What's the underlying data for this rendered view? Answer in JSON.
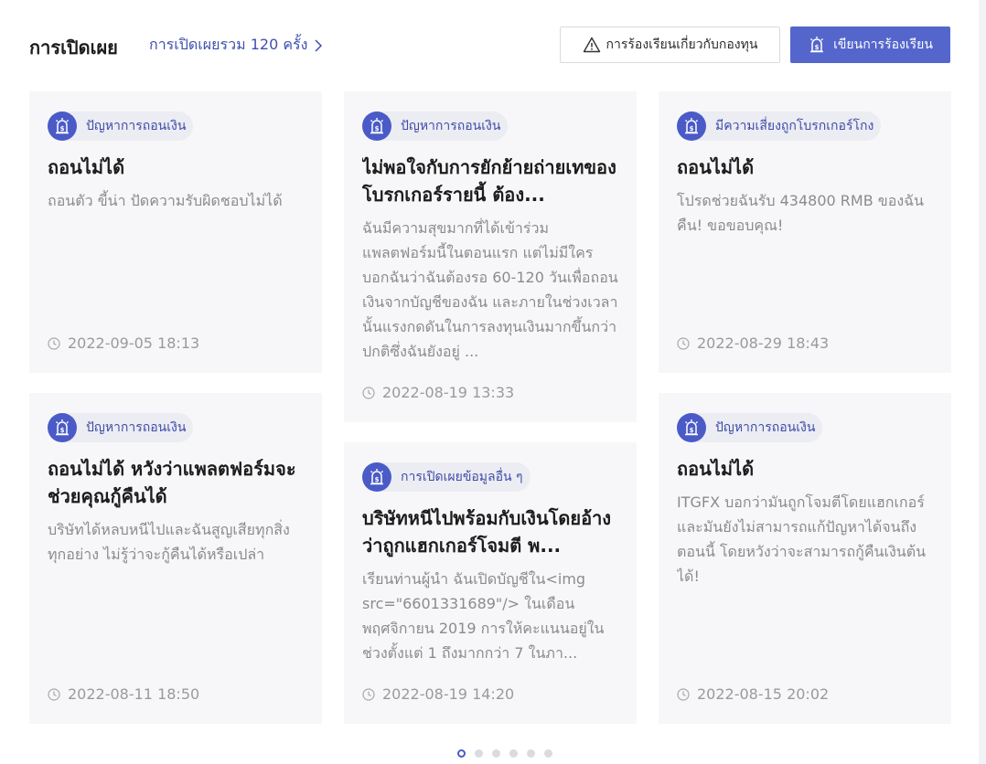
{
  "header": {
    "title": "การเปิดเผย",
    "count_link": "การเปิดเผยรวม 120 ครั้ง",
    "complain_button": "การร้องเรียนเกี่ยวกับกองทุน",
    "write_button": "เขียนการร้องเรียน"
  },
  "colors": {
    "accent": "#5466cc",
    "badge": "#4a5bc7",
    "card_bg": "#f7f7f9"
  },
  "icons": {
    "tag": "shield-dollar-icon",
    "date": "clock-icon",
    "warning": "warning-triangle-icon",
    "chevron": "chevron-right-icon"
  },
  "cards": [
    {
      "tag": "ปัญหาการถอนเงิน",
      "title": "ถอนไม่ได้",
      "body": "ถอนตัว ขี้น่า ปัดความรับผิดชอบไม่ได้",
      "date": "2022-09-05 18:13"
    },
    {
      "tag": "ปัญหาการถอนเงิน",
      "title": "ไม่พอใจกับการยักย้ายถ่ายเทของโบรกเกอร์รายนี้ ต้อง...",
      "body": "ฉันมีความสุขมากที่ได้เข้าร่วมแพลตฟอร์มนี้ในตอนแรก แต่ไม่มีใครบอกฉันว่าฉันต้องรอ 60-120 วันเพื่อถอนเงินจากบัญชีของฉัน และภายในช่วงเวลานั้นแรงกดดันในการลงทุนเงินมากขึ้นกว่าปกติซึ่งฉันยังอยู่ ...",
      "date": "2022-08-19 13:33"
    },
    {
      "tag": "มีความเสี่ยงถูกโบรกเกอร์โกง",
      "title": "ถอนไม่ได้",
      "body": "โปรดช่วยฉันรับ 434800 RMB ของฉันคืน! ขอขอบคุณ!",
      "date": "2022-08-29 18:43"
    },
    {
      "tag": "ปัญหาการถอนเงิน",
      "title": "ถอนไม่ได้ หวังว่าแพลตฟอร์มจะช่วยคุณกู้คืนได้",
      "body": "บริษัทได้หลบหนีไปและฉันสูญเสียทุกสิ่งทุกอย่าง ไม่รู้ว่าจะกู้คืนได้หรือเปล่า",
      "date": "2022-08-11 18:50"
    },
    {
      "tag": "การเปิดเผยข้อมูลอื่น ๆ",
      "title": "บริษัทหนีไปพร้อมกับเงินโดยอ้างว่าถูกแฮกเกอร์โจมตี พ...",
      "body": "เรียนท่านผู้นำ ฉันเปิดบัญชีใน<img src=\"6601331689\"/> ในเดือนพฤศจิกายน 2019 การให้คะแนนอยู่ในช่วงตั้งแต่ 1 ถึงมากกว่า 7 ในภา...",
      "date": "2022-08-19 14:20"
    },
    {
      "tag": "ปัญหาการถอนเงิน",
      "title": "ถอนไม่ได้",
      "body": "ITGFX บอกว่ามันถูกโจมตีโดยแฮกเกอร์ และมันยังไม่สามารถแก้ปัญหาได้จนถึงตอนนี้ โดยหวังว่าจะสามารถกู้คืนเงินต้นได้!",
      "date": "2022-08-15 20:02"
    }
  ],
  "pagination": {
    "total": 6,
    "active": 1
  }
}
